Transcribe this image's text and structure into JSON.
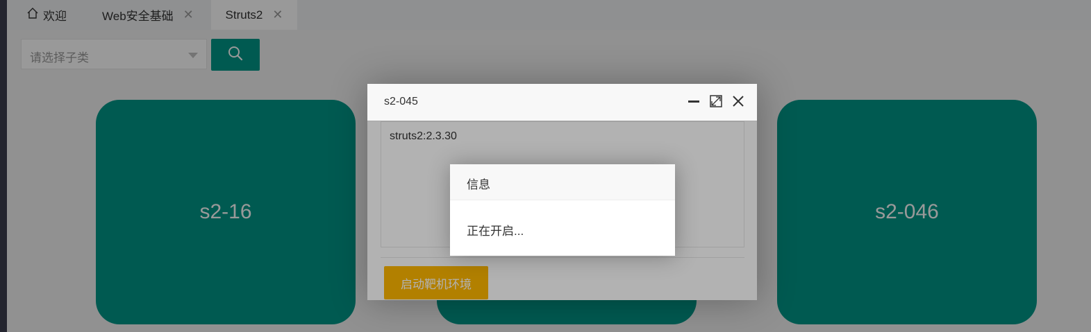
{
  "tabs": [
    {
      "label": "欢迎",
      "icon": "home-icon",
      "closable": false
    },
    {
      "label": "Web安全基础",
      "closable": true
    },
    {
      "label": "Struts2",
      "closable": true,
      "active": true
    }
  ],
  "filter": {
    "select_placeholder": "请选择子类",
    "search_icon": "search-icon"
  },
  "cards": [
    {
      "label": "s2-16"
    },
    {
      "label": ""
    },
    {
      "label": "s2-046"
    }
  ],
  "dialog": {
    "title": "s2-045",
    "textarea_value": "struts2:2.3.30",
    "start_button": "启动靶机环境"
  },
  "message": {
    "title": "信息",
    "body": "正在开启..."
  },
  "colors": {
    "accent": "#009688",
    "warning": "#ffb800"
  }
}
